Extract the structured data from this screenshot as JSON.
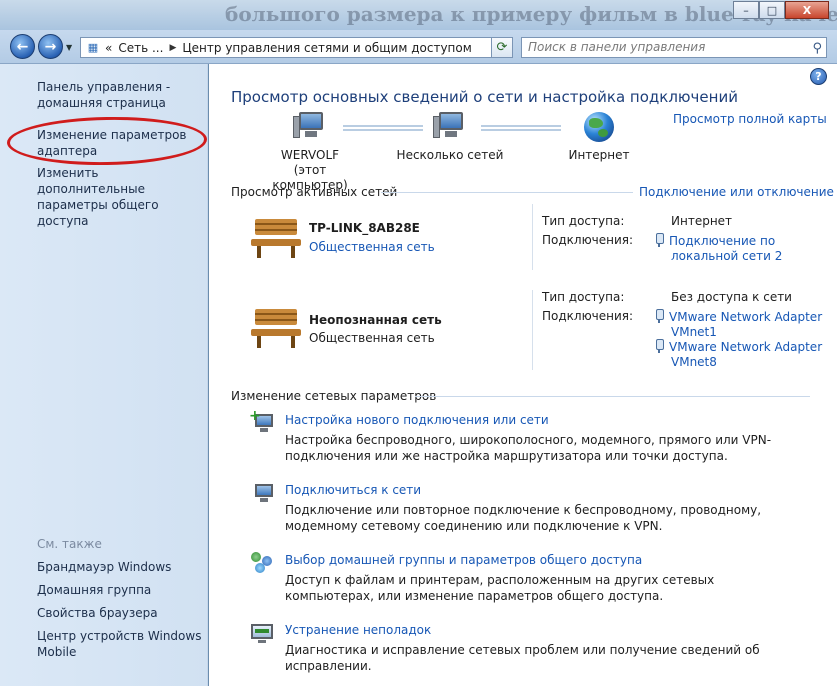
{
  "window": {
    "background_text": "большого размера к примеру фильм в blue-ray качестве",
    "buttons": {
      "minimize": "–",
      "maximize": "□",
      "close": "X"
    }
  },
  "navbar": {
    "back": "←",
    "forward": "→",
    "address": {
      "prefix": "«",
      "crumb1": "Сеть ...",
      "crumb2": "Центр управления сетями и общим доступом"
    },
    "search_placeholder": "Поиск в панели управления"
  },
  "sidebar": {
    "home": "Панель управления - домашняя страница",
    "adapter": "Изменение параметров адаптера",
    "sharing": "Изменить дополнительные параметры общего доступа",
    "see_also": "См. также",
    "links": [
      "Брандмауэр Windows",
      "Домашняя группа",
      "Свойства браузера",
      "Центр устройств Windows Mobile"
    ]
  },
  "main": {
    "title": "Просмотр основных сведений о сети и настройка подключений",
    "full_map": "Просмотр полной карты",
    "map": {
      "computer_name": "WERVOLF",
      "computer_sub": "(этот компьютер)",
      "networks": "Несколько сетей",
      "internet": "Интернет"
    },
    "active_networks_head": "Просмотр активных сетей",
    "connect_disconnect": "Подключение или отключение",
    "access_type_label": "Тип доступа:",
    "connections_label": "Подключения:",
    "net1": {
      "name": "TP-LINK_8AB28E",
      "type": "Общественная сеть",
      "access": "Интернет",
      "conn1": "Подключение по",
      "conn2": "локальной сети 2"
    },
    "net2": {
      "name": "Неопознанная сеть",
      "type": "Общественная сеть",
      "access": "Без доступа к сети",
      "c1a": "VMware Network Adapter",
      "c1b": "VMnet1",
      "c2a": "VMware Network Adapter",
      "c2b": "VMnet8"
    },
    "change_head": "Изменение сетевых параметров",
    "tasks": [
      {
        "link": "Настройка нового подключения или сети",
        "desc": "Настройка беспроводного, широкополосного, модемного, прямого или VPN-подключения или же настройка маршрутизатора или точки доступа."
      },
      {
        "link": "Подключиться к сети",
        "desc": "Подключение или повторное подключение к беспроводному, проводному, модемному сетевому соединению или подключение к VPN."
      },
      {
        "link": "Выбор домашней группы и параметров общего доступа",
        "desc": "Доступ к файлам и принтерам, расположенным на других сетевых компьютерах, или изменение параметров общего доступа."
      },
      {
        "link": "Устранение неполадок",
        "desc": "Диагностика и исправление сетевых проблем или получение сведений об исправлении."
      }
    ],
    "help": "?"
  }
}
